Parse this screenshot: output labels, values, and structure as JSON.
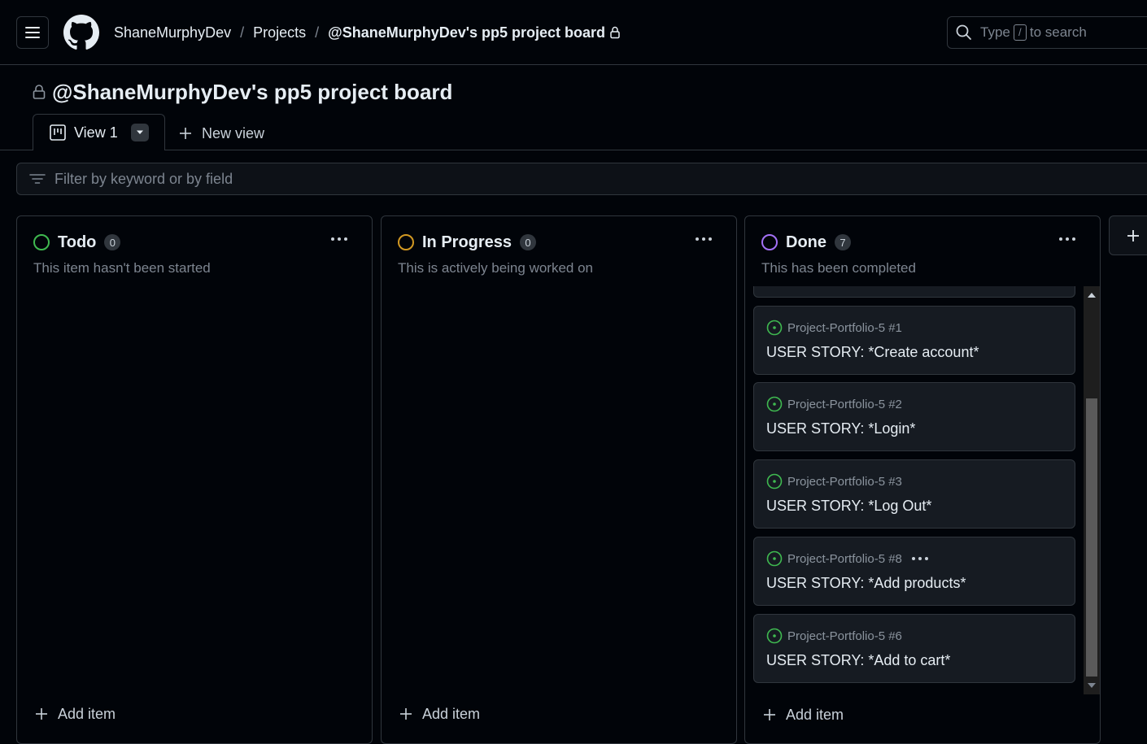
{
  "header": {
    "breadcrumbs": [
      "ShaneMurphyDev",
      "Projects",
      "@ShaneMurphyDev's pp5 project board"
    ],
    "search": {
      "prefix": "Type",
      "key": "/",
      "suffix": "to search"
    },
    "icons": {
      "menu": "hamburger-icon",
      "logo": "github-logo",
      "lock": "lock-icon",
      "search": "search-icon"
    }
  },
  "project": {
    "title": "@ShaneMurphyDev's pp5 project board"
  },
  "tabs": {
    "view_label": "View 1",
    "new_view_label": "New view"
  },
  "filter": {
    "placeholder": "Filter by keyword or by field"
  },
  "columns": [
    {
      "name": "Todo",
      "count": "0",
      "color": "#3fb950",
      "description": "This item hasn't been started",
      "add_label": "Add item"
    },
    {
      "name": "In Progress",
      "count": "0",
      "color": "#d29922",
      "description": "This is actively being worked on",
      "add_label": "Add item"
    },
    {
      "name": "Done",
      "count": "7",
      "color": "#a371f7",
      "description": "This has been completed",
      "add_label": "Add item",
      "cards": [
        {
          "ref": "Project-Portfolio-5 #1",
          "title": "USER STORY: *Create account*"
        },
        {
          "ref": "Project-Portfolio-5 #2",
          "title": "USER STORY: *Login*"
        },
        {
          "ref": "Project-Portfolio-5 #3",
          "title": "USER STORY: *Log Out*"
        },
        {
          "ref": "Project-Portfolio-5 #8",
          "title": "USER STORY: *Add products*"
        },
        {
          "ref": "Project-Portfolio-5 #6",
          "title": "USER STORY: *Add to cart*"
        }
      ]
    }
  ],
  "colors": {
    "background": "#010409",
    "border": "#30363d",
    "card": "#161b22",
    "open_issue": "#3fb950"
  }
}
